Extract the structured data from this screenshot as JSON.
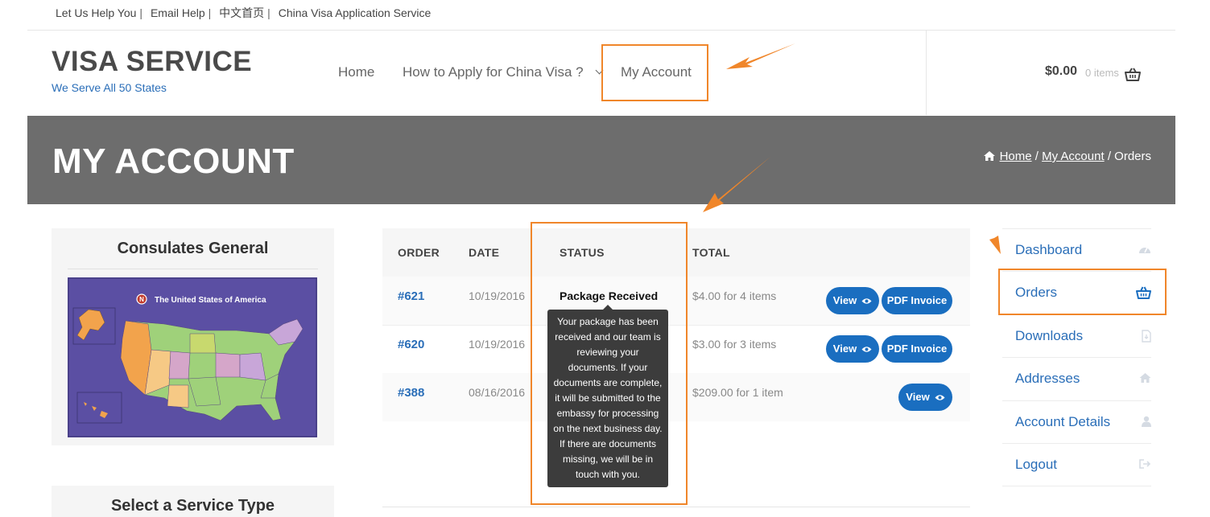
{
  "topbar": {
    "links": [
      "Let Us Help You",
      "Email Help",
      "中文首页",
      "China Visa Application Service"
    ],
    "separator": "|"
  },
  "header": {
    "logo_title": "VISA SERVICE",
    "logo_tagline": "We Serve All 50 States",
    "nav": {
      "home": "Home",
      "how_to_apply": "How to Apply for China Visa ?",
      "my_account": "My Account"
    },
    "cart": {
      "price": "$0.00",
      "items": "0 items",
      "icon": "basket-icon"
    }
  },
  "banner": {
    "title": "MY ACCOUNT",
    "breadcrumb": {
      "home": "Home",
      "my_account": "My Account",
      "separator": "/",
      "current": "Orders"
    }
  },
  "sidebar": {
    "consulates_title": "Consulates General",
    "map_title": "The United States of America",
    "map_badge": "N",
    "service_title": "Select a Service Type"
  },
  "orders": {
    "headers": [
      "ORDER",
      "DATE",
      "STATUS",
      "TOTAL"
    ],
    "rows": [
      {
        "order": "#621",
        "date": "10/19/2016",
        "status": "Package Received",
        "total": "$4.00 for 4 items",
        "actions": [
          "View",
          "PDF Invoice"
        ]
      },
      {
        "order": "#620",
        "date": "10/19/2016",
        "status": "",
        "total": "$3.00 for 3 items",
        "actions": [
          "View",
          "PDF Invoice"
        ]
      },
      {
        "order": "#388",
        "date": "08/16/2016",
        "status": "",
        "total": "$209.00 for 1 item",
        "actions": [
          "View"
        ]
      }
    ],
    "tooltip": "Your package has been received and our team is reviewing your documents. If your documents are complete, it will be submitted to the embassy for processing on the next business day. If there are documents missing, we will be in touch with you."
  },
  "account_nav": {
    "items": [
      {
        "label": "Dashboard",
        "icon": "dashboard-icon"
      },
      {
        "label": "Orders",
        "icon": "basket-icon"
      },
      {
        "label": "Downloads",
        "icon": "file-download-icon"
      },
      {
        "label": "Addresses",
        "icon": "home-icon"
      },
      {
        "label": "Account Details",
        "icon": "user-icon"
      },
      {
        "label": "Logout",
        "icon": "sign-out-icon"
      }
    ]
  },
  "colors": {
    "accent": "#f0862a",
    "link": "#2a6eb8",
    "button": "#1a6ec0",
    "banner": "#6d6d6d"
  }
}
